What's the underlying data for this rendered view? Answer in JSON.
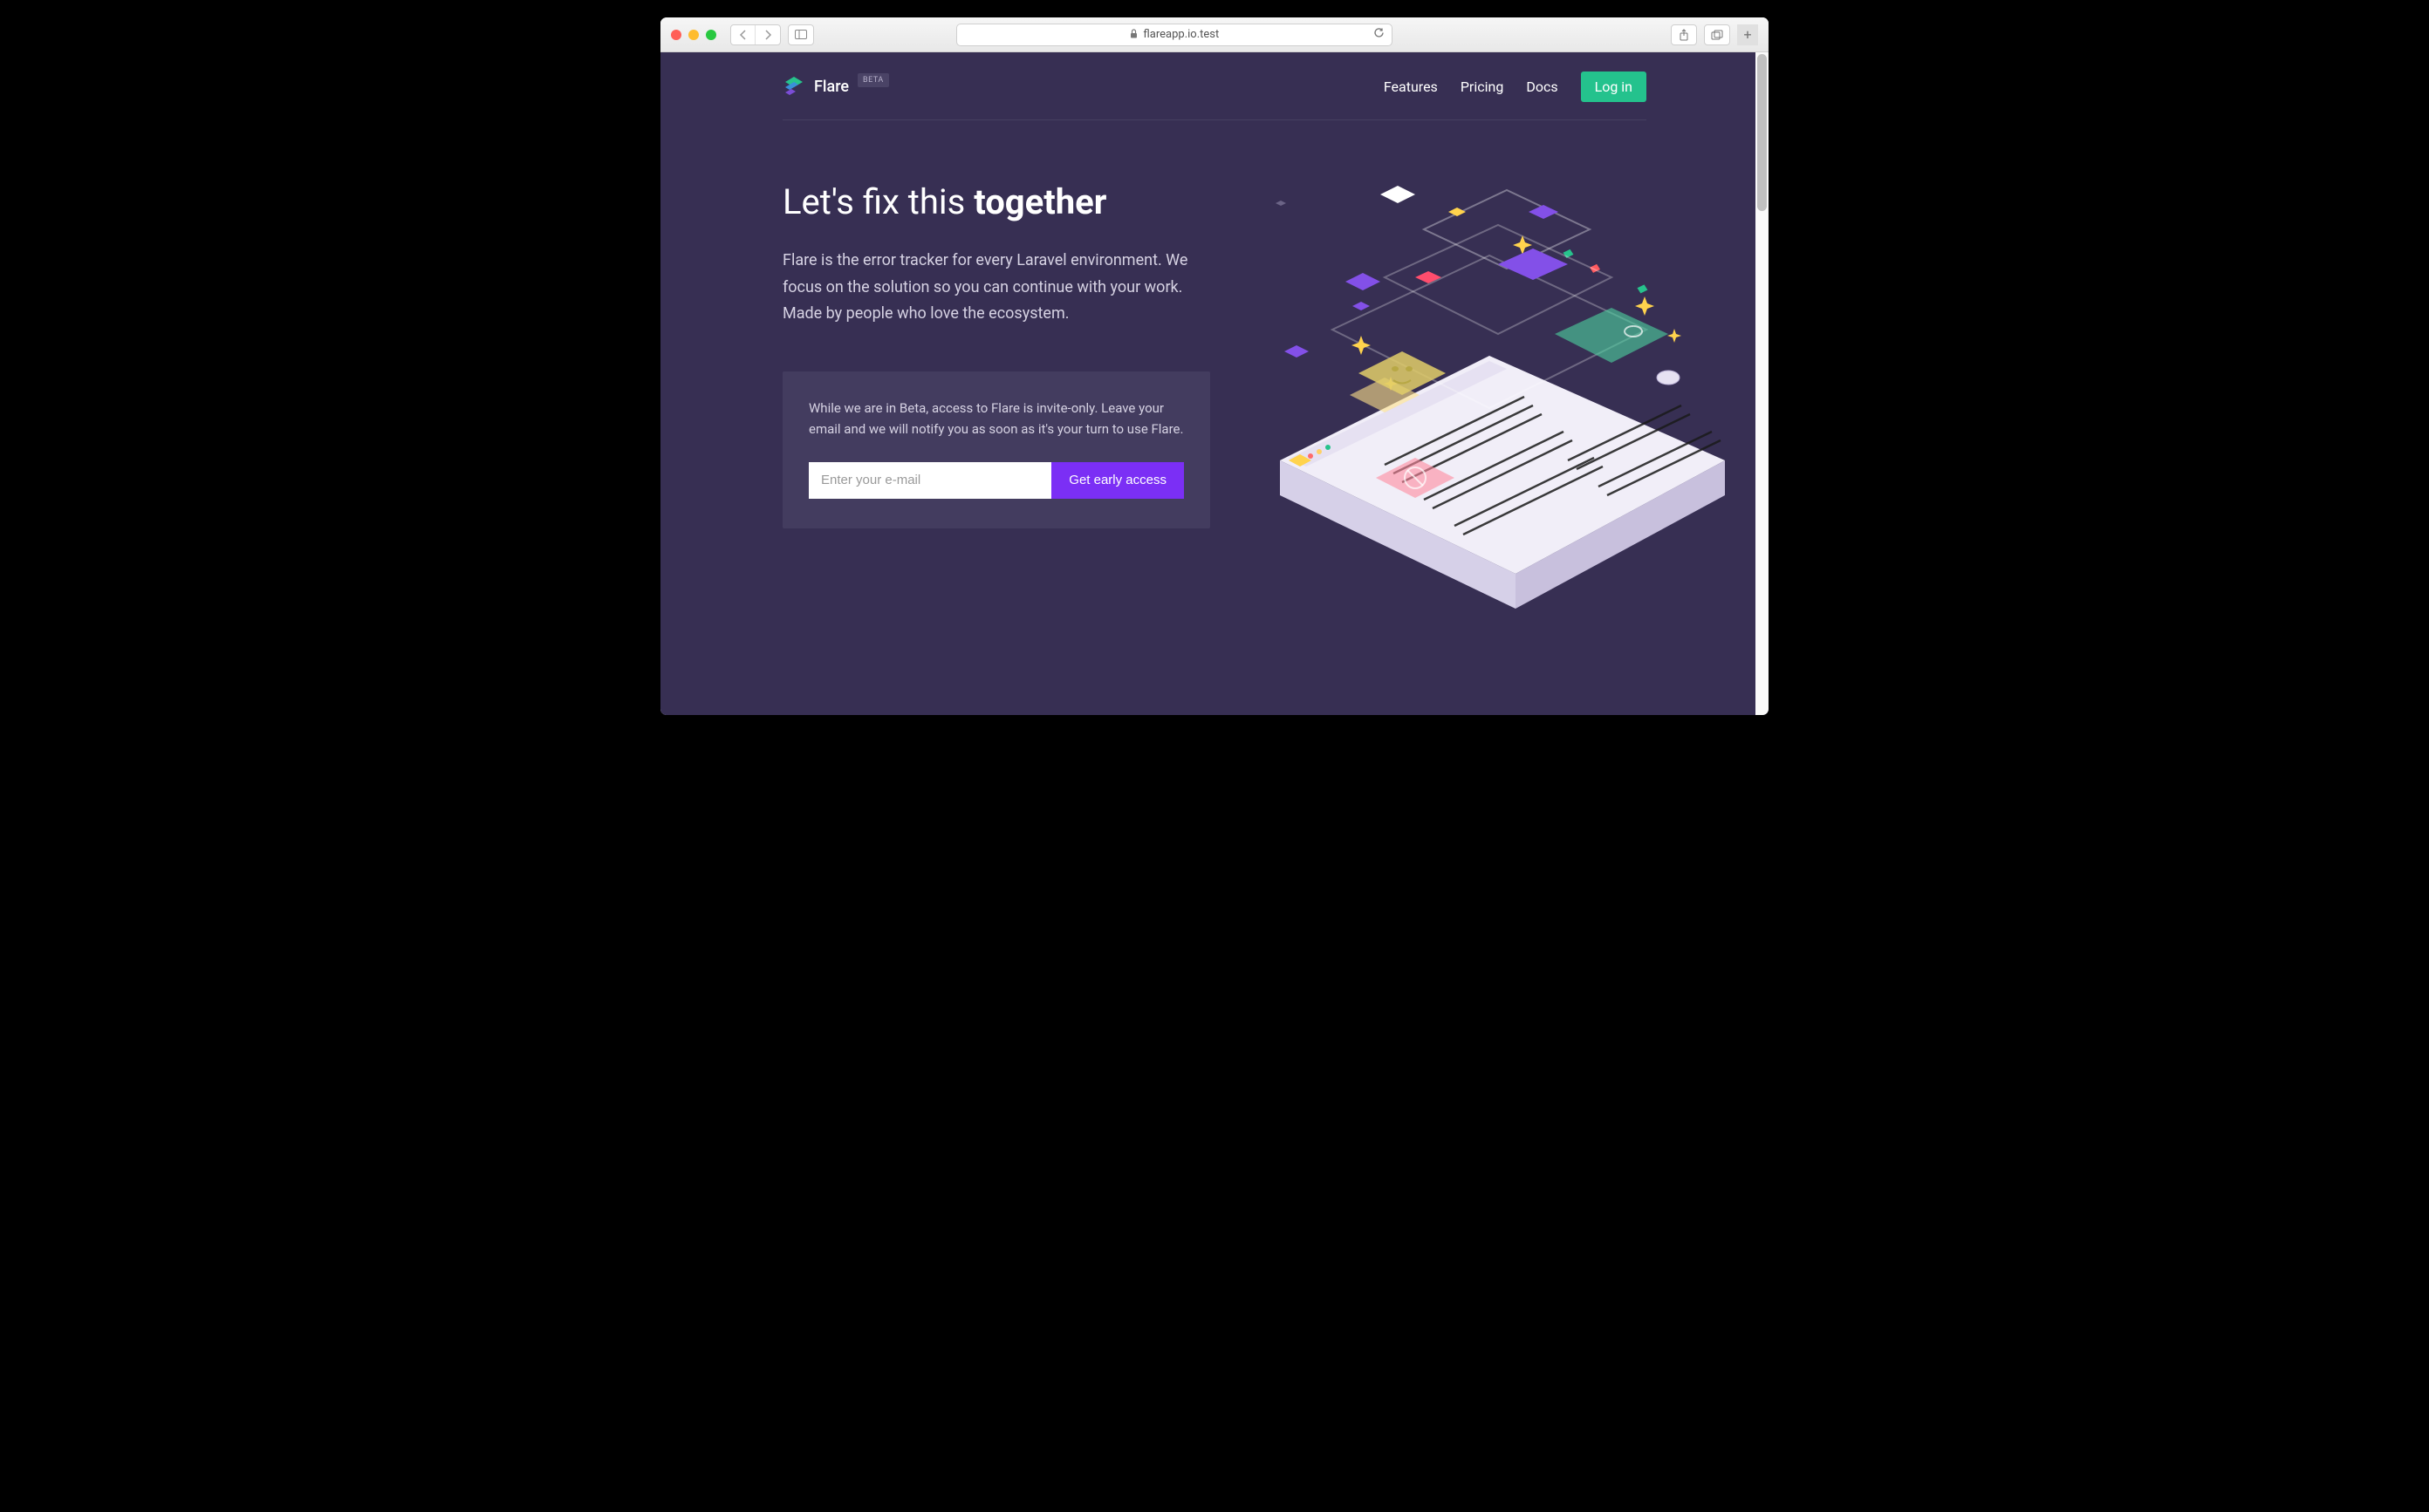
{
  "browser": {
    "url": "flareapp.io.test"
  },
  "brand": {
    "name": "Flare",
    "badge": "BETA"
  },
  "nav": {
    "features": "Features",
    "pricing": "Pricing",
    "docs": "Docs",
    "login": "Log in"
  },
  "hero": {
    "title_pre": "Let's fix this ",
    "title_bold": "together",
    "description": "Flare is the error tracker for every Laravel environment. We focus on the solution so you can continue with your work. Made by people who love the ecosystem."
  },
  "signup": {
    "text": "While we are in Beta, access to Flare is invite-only. Leave your email and we will notify you as soon as it's your turn to use Flare.",
    "placeholder": "Enter your e-mail",
    "button": "Get early access"
  },
  "colors": {
    "bg": "#372f53",
    "card": "#433c5f",
    "accent_green": "#24c28d",
    "accent_purple": "#7b2ff5"
  }
}
